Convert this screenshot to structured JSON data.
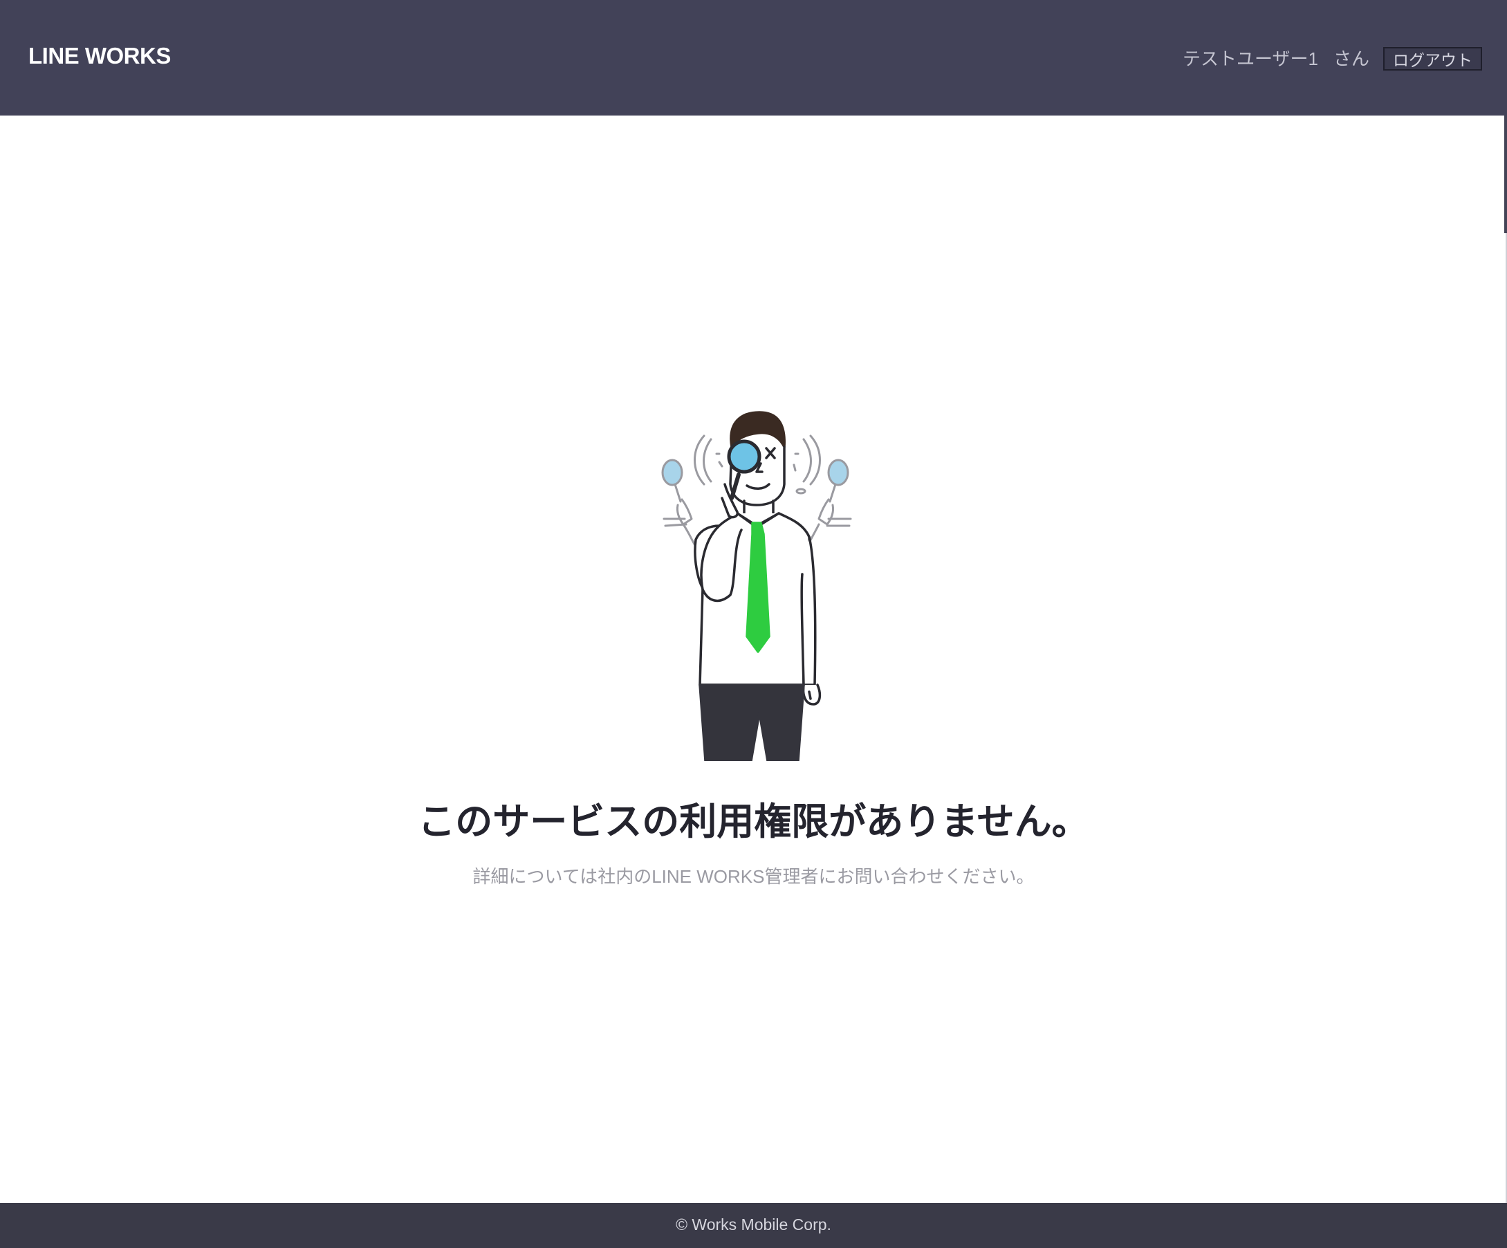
{
  "header": {
    "logo_text": "LINE WORKS",
    "user_name": "テストユーザー1",
    "user_suffix": "さん",
    "logout_label": "ログアウト"
  },
  "main": {
    "title": "このサービスの利用権限がありません。",
    "description": "詳細については社内のLINE WORKS管理者にお問い合わせください。",
    "illustration_icon": "man-with-magnifying-glass-illustration"
  },
  "footer": {
    "copyright": "© Works Mobile Corp."
  },
  "colors": {
    "header_bg": "#424258",
    "footer_bg": "#3a3a48",
    "tie_green": "#2ecc40",
    "lens_blue": "#6ec3e6"
  }
}
